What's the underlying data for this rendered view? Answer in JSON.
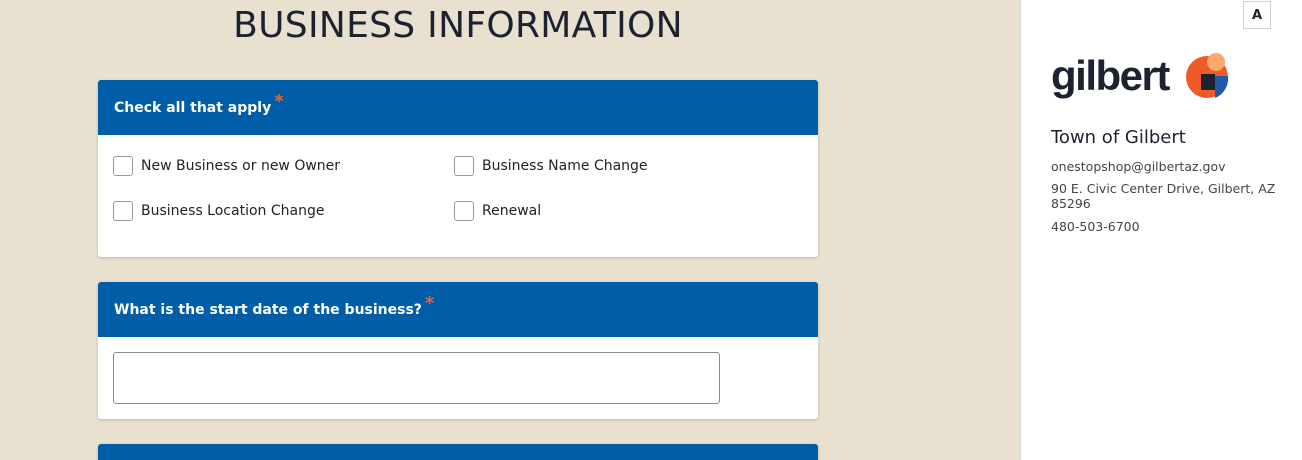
{
  "page": {
    "title": "BUSINESS INFORMATION"
  },
  "question1": {
    "label": "Check all that apply",
    "required_mark": "*",
    "options": [
      "New Business or new Owner",
      "Business Name Change",
      "Business Location Change",
      "Renewal"
    ]
  },
  "question2": {
    "label": "What is the start date of the business?",
    "required_mark": "*",
    "value": ""
  },
  "sidebar": {
    "a11y_label": "A",
    "logo_text": "gilbert",
    "org_name": "Town of Gilbert",
    "email": "onestopshop@gilbertaz.gov",
    "address": "90 E. Civic Center Drive, Gilbert, AZ 85296",
    "phone": "480-503-6700"
  },
  "colors": {
    "header_blue": "#005ea8",
    "required_orange": "#ff5a2b",
    "background": "#e8e1d0"
  }
}
